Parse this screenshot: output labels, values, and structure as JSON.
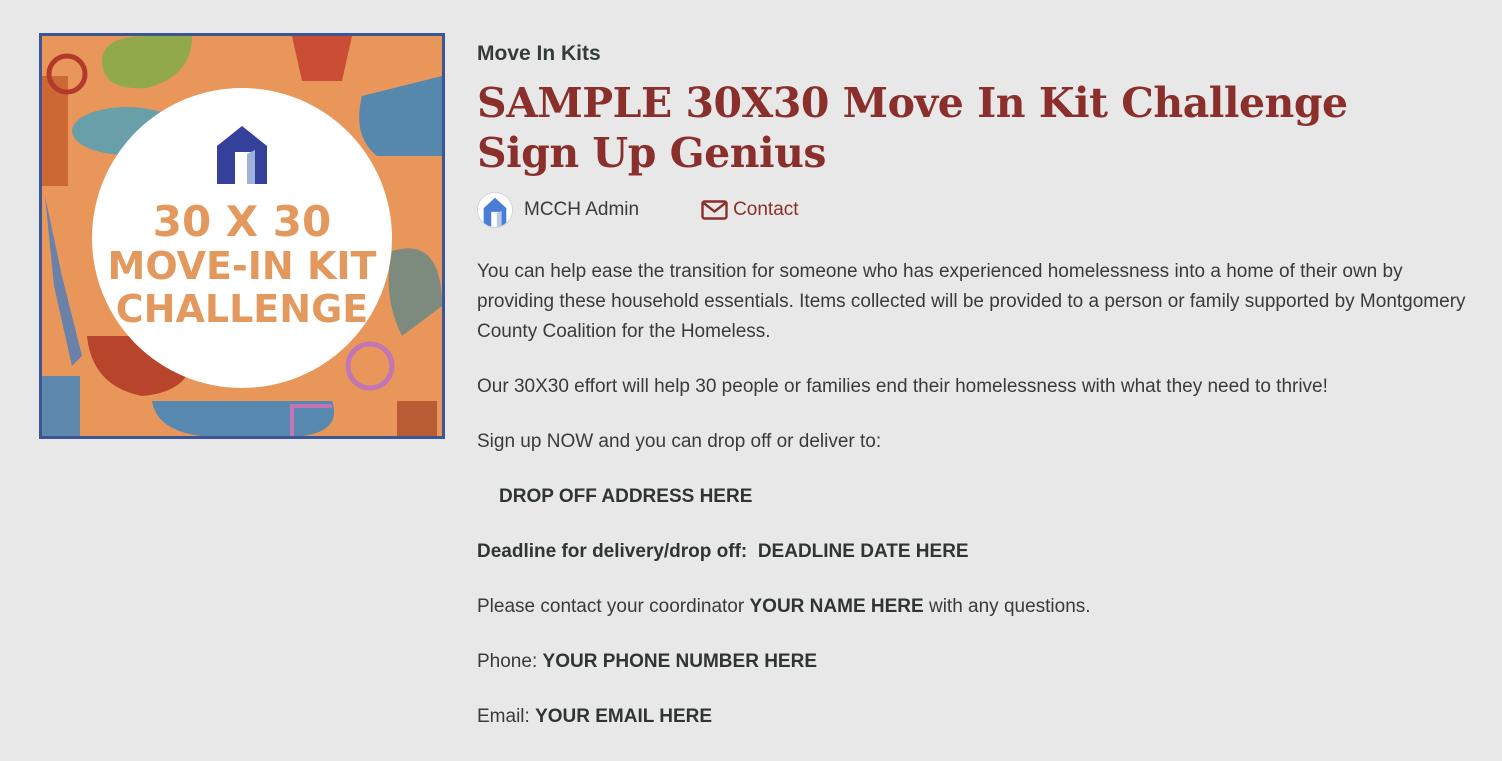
{
  "hero_image": {
    "alt_lines": [
      "30 X 30",
      "MOVE-IN KIT",
      "CHALLENGE"
    ]
  },
  "category": "Move In Kits",
  "title": "SAMPLE 30X30 Move In Kit Challenge Sign Up Genius",
  "author": {
    "name": "MCCH Admin",
    "avatar_icon": "house-logo-icon"
  },
  "contact": {
    "label": "Contact",
    "icon": "mail-icon"
  },
  "body": {
    "p1": "You can help ease the transition for someone who has experienced homelessness into a home of their own by providing these household essentials. Items collected will be provided to a person or family supported by Montgomery County Coalition for the Homeless.",
    "p2": "Our 30X30 effort will help 30 people or families end their homelessness with what they need to thrive!",
    "p3": "Sign up NOW and you can drop off or deliver to:",
    "address": "DROP OFF ADDRESS HERE",
    "deadline_label": "Deadline for delivery/drop off:",
    "deadline_value": "DEADLINE DATE HERE",
    "coordinator_prefix": "Please contact your coordinator",
    "coordinator_name": "YOUR NAME HERE",
    "coordinator_suffix": "with any questions.",
    "phone_label": "Phone:",
    "phone_value": "YOUR PHONE NUMBER HERE",
    "email_label": "Email:",
    "email_value": "YOUR EMAIL HERE"
  },
  "colors": {
    "title": "#8a2f2b",
    "background": "#e8e8e8",
    "hero_orange": "#e9965a",
    "hero_border": "#3b5597",
    "logo_blue": "#34409a"
  }
}
